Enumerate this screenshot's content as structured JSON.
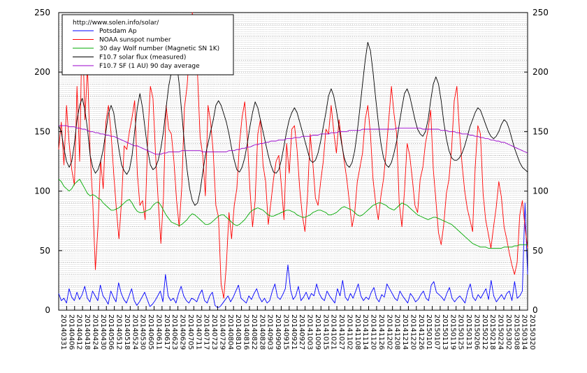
{
  "chart_data": {
    "type": "line",
    "title": "",
    "xlabel": "",
    "ylabel": "",
    "ylim": [
      0,
      250
    ],
    "yticks": [
      0,
      50,
      100,
      150,
      200,
      250
    ],
    "grid": true,
    "legend_placement": "top-left",
    "legend_source": "http://www.solen.info/solar/",
    "x_tick_labels": [
      "20140331",
      "20140406",
      "20140412",
      "20140418",
      "20140424",
      "20140430",
      "20140506",
      "20140512",
      "20140518",
      "20140524",
      "20140530",
      "20140605",
      "20140611",
      "20140617",
      "20140623",
      "20140629",
      "20140705",
      "20140711",
      "20140717",
      "20140723",
      "20140729",
      "20140804",
      "20140810",
      "20140816",
      "20140822",
      "20140828",
      "20140903",
      "20140909",
      "20140915",
      "20140921",
      "20140927",
      "20141003",
      "20141009",
      "20141015",
      "20141021",
      "20141027",
      "20141102",
      "20141108",
      "20141114",
      "20141120",
      "20141126",
      "20141202",
      "20141208",
      "20141214",
      "20141220",
      "20141226",
      "20150101",
      "20150107",
      "20150113",
      "20150119",
      "20150125",
      "20150131",
      "20150206",
      "20150212",
      "20150218",
      "20150224",
      "20150302",
      "20150308",
      "20150314",
      "20150320"
    ],
    "series": [
      {
        "name": "Potsdam Ap",
        "color": "#0000ff",
        "values": [
          14,
          8,
          10,
          6,
          18,
          11,
          8,
          15,
          9,
          13,
          20,
          10,
          7,
          16,
          12,
          8,
          21,
          12,
          9,
          5,
          16,
          11,
          7,
          23,
          14,
          9,
          6,
          12,
          18,
          8,
          4,
          7,
          11,
          15,
          9,
          3,
          5,
          8,
          12,
          16,
          7,
          30,
          12,
          8,
          10,
          6,
          14,
          20,
          12,
          8,
          6,
          10,
          9,
          7,
          13,
          17,
          8,
          6,
          12,
          15,
          4,
          2,
          3,
          6,
          9,
          12,
          7,
          11,
          16,
          21,
          10,
          8,
          6,
          12,
          9,
          14,
          18,
          11,
          7,
          10,
          6,
          8,
          16,
          22,
          11,
          9,
          13,
          18,
          38,
          17,
          9,
          12,
          20,
          8,
          11,
          15,
          9,
          14,
          12,
          22,
          14,
          10,
          8,
          16,
          12,
          9,
          6,
          18,
          12,
          25,
          11,
          8,
          14,
          10,
          16,
          22,
          12,
          8,
          11,
          9,
          15,
          19,
          10,
          7,
          13,
          11,
          22,
          18,
          14,
          10,
          8,
          16,
          12,
          9,
          6,
          14,
          11,
          7,
          9,
          13,
          16,
          10,
          8,
          21,
          24,
          15,
          13,
          11,
          8,
          14,
          19,
          10,
          7,
          10,
          12,
          9,
          6,
          16,
          22,
          11,
          8,
          13,
          10,
          14,
          18,
          9,
          25,
          12,
          7,
          10,
          13,
          9,
          14,
          16,
          8,
          24,
          10,
          12,
          16,
          90,
          30
        ]
      },
      {
        "name": "NOAA sunspot number",
        "color": "#ff0000",
        "values": [
          135,
          158,
          122,
          172,
          140,
          118,
          105,
          188,
          125,
          245,
          160,
          205,
          132,
          92,
          34,
          70,
          126,
          102,
          158,
          172,
          148,
          115,
          85,
          60,
          92,
          138,
          135,
          150,
          162,
          176,
          115,
          88,
          92,
          76,
          145,
          188,
          178,
          130,
          92,
          56,
          95,
          172,
          152,
          148,
          125,
          92,
          70,
          104,
          170,
          188,
          220,
          250,
          210,
          198,
          145,
          130,
          96,
          172,
          158,
          132,
          88,
          78,
          22,
          10,
          38,
          82,
          60,
          88,
          102,
          140,
          162,
          175,
          145,
          102,
          70,
          92,
          148,
          160,
          122,
          108,
          72,
          90,
          110,
          125,
          130,
          105,
          76,
          140,
          115,
          152,
          155,
          135,
          102,
          80,
          66,
          96,
          148,
          124,
          94,
          88,
          108,
          125,
          152,
          148,
          172,
          150,
          132,
          160,
          142,
          125,
          110,
          90,
          70,
          82,
          108,
          120,
          132,
          160,
          172,
          148,
          110,
          90,
          76,
          96,
          110,
          133,
          160,
          188,
          165,
          148,
          90,
          70,
          100,
          140,
          130,
          110,
          88,
          82,
          110,
          120,
          140,
          152,
          168,
          118,
          92,
          65,
          55,
          72,
          98,
          110,
          136,
          176,
          188,
          150,
          122,
          100,
          85,
          76,
          66,
          120,
          155,
          148,
          98,
          76,
          64,
          52,
          70,
          86,
          108,
          95,
          70,
          60,
          48,
          38,
          30,
          40,
          80,
          92,
          70,
          52
        ]
      },
      {
        "name": "30 day Wolf number (Magnetic SN 1K)",
        "color": "#00aa00",
        "values": [
          110,
          108,
          104,
          102,
          100,
          102,
          106,
          108,
          110,
          106,
          102,
          98,
          96,
          97,
          96,
          94,
          93,
          90,
          88,
          86,
          84,
          84,
          85,
          86,
          88,
          90,
          92,
          93,
          90,
          86,
          83,
          82,
          82,
          83,
          84,
          85,
          88,
          90,
          91,
          88,
          84,
          80,
          77,
          74,
          73,
          72,
          71,
          72,
          74,
          76,
          79,
          81,
          80,
          78,
          76,
          74,
          72,
          72,
          73,
          75,
          77,
          79,
          80,
          80,
          78,
          76,
          74,
          72,
          71,
          72,
          74,
          76,
          79,
          82,
          84,
          85,
          86,
          85,
          84,
          82,
          80,
          79,
          79,
          80,
          81,
          82,
          83,
          84,
          84,
          83,
          82,
          80,
          79,
          78,
          78,
          79,
          80,
          82,
          83,
          84,
          84,
          83,
          82,
          80,
          80,
          81,
          82,
          84,
          86,
          87,
          86,
          85,
          84,
          82,
          80,
          79,
          80,
          82,
          84,
          86,
          88,
          89,
          90,
          90,
          89,
          88,
          86,
          85,
          84,
          86,
          88,
          90,
          89,
          88,
          86,
          84,
          82,
          80,
          79,
          78,
          77,
          76,
          77,
          78,
          78,
          77,
          76,
          75,
          74,
          73,
          72,
          70,
          68,
          66,
          64,
          62,
          60,
          58,
          56,
          55,
          54,
          53,
          53,
          53,
          52,
          52,
          52,
          52,
          52,
          52,
          53,
          53,
          53,
          53,
          54,
          54,
          55,
          55,
          55,
          55
        ]
      },
      {
        "name": "F10.7 solar flux (measured)",
        "color": "#000000",
        "values": [
          155,
          150,
          136,
          125,
          120,
          125,
          140,
          160,
          172,
          178,
          168,
          152,
          130,
          120,
          115,
          118,
          125,
          135,
          150,
          165,
          172,
          166,
          150,
          135,
          122,
          117,
          114,
          118,
          130,
          150,
          170,
          182,
          170,
          152,
          134,
          122,
          118,
          120,
          126,
          136,
          150,
          170,
          188,
          200,
          210,
          208,
          190,
          165,
          140,
          118,
          102,
          92,
          88,
          90,
          100,
          116,
          130,
          140,
          150,
          160,
          172,
          176,
          172,
          165,
          158,
          148,
          136,
          126,
          118,
          116,
          120,
          128,
          140,
          154,
          166,
          175,
          170,
          160,
          150,
          140,
          130,
          122,
          116,
          115,
          118,
          126,
          138,
          150,
          160,
          166,
          170,
          166,
          158,
          150,
          142,
          134,
          126,
          124,
          126,
          132,
          142,
          154,
          166,
          180,
          186,
          180,
          168,
          154,
          140,
          128,
          122,
          120,
          124,
          134,
          150,
          170,
          190,
          210,
          225,
          218,
          200,
          178,
          158,
          140,
          128,
          122,
          120,
          124,
          132,
          142,
          156,
          170,
          182,
          186,
          180,
          170,
          160,
          152,
          148,
          146,
          150,
          160,
          176,
          190,
          196,
          190,
          176,
          158,
          144,
          134,
          128,
          126,
          126,
          128,
          132,
          138,
          146,
          154,
          160,
          166,
          170,
          168,
          162,
          156,
          150,
          146,
          144,
          146,
          150,
          156,
          160,
          158,
          152,
          144,
          136,
          130,
          124,
          120,
          118,
          116
        ]
      },
      {
        "name": "F10.7 SF (1 AU) 90 day average",
        "color": "#9900cc",
        "values": [
          155,
          155,
          155,
          155,
          154,
          154,
          154,
          153,
          153,
          152,
          152,
          151,
          150,
          150,
          149,
          149,
          148,
          148,
          147,
          147,
          146,
          146,
          145,
          144,
          143,
          142,
          141,
          140,
          139,
          138,
          138,
          137,
          136,
          135,
          134,
          133,
          132,
          131,
          131,
          131,
          132,
          132,
          133,
          133,
          133,
          133,
          133,
          134,
          134,
          134,
          134,
          134,
          134,
          134,
          134,
          133,
          133,
          133,
          133,
          133,
          133,
          133,
          133,
          133,
          133,
          134,
          134,
          134,
          135,
          135,
          136,
          136,
          137,
          137,
          138,
          139,
          139,
          140,
          140,
          141,
          141,
          142,
          142,
          142,
          143,
          143,
          143,
          144,
          144,
          144,
          145,
          145,
          145,
          146,
          146,
          146,
          146,
          147,
          147,
          147,
          148,
          148,
          148,
          148,
          149,
          149,
          149,
          150,
          150,
          150,
          150,
          151,
          151,
          151,
          151,
          151,
          152,
          152,
          152,
          152,
          152,
          152,
          152,
          152,
          152,
          152,
          152,
          152,
          152,
          153,
          153,
          153,
          153,
          153,
          153,
          153,
          153,
          153,
          153,
          152,
          152,
          152,
          152,
          152,
          152,
          152,
          151,
          151,
          151,
          150,
          150,
          150,
          149,
          149,
          148,
          148,
          148,
          147,
          147,
          146,
          146,
          145,
          145,
          144,
          144,
          143,
          143,
          142,
          142,
          141,
          141,
          140,
          139,
          138,
          137,
          136,
          135,
          134,
          133,
          132
        ]
      }
    ]
  }
}
